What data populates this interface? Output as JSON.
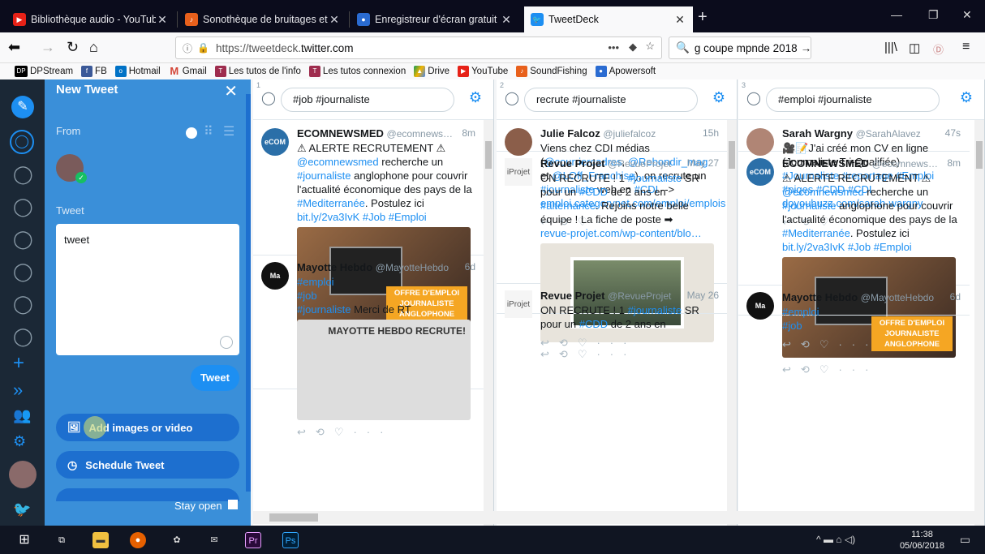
{
  "tabs": [
    {
      "title": "Bibliothèque audio - YouTube",
      "active": false
    },
    {
      "title": "Sonothèque de bruitages et mu",
      "active": false
    },
    {
      "title": "Enregistreur d'écran gratuit - e",
      "active": false
    },
    {
      "title": "TweetDeck",
      "active": true
    }
  ],
  "nav": {
    "url_prefix": "https://tweetdeck.",
    "url_domain": "twitter.com",
    "search": "ɡ coupe mpnde 2018"
  },
  "bookmarks": [
    "DPStream",
    "FB",
    "Hotmail",
    "Gmail",
    "Les tutos de l'info",
    "Les tutos connexion",
    "Drive",
    "YouTube",
    "SoundFishing",
    "Apowersoft"
  ],
  "compose": {
    "title": "New Tweet",
    "from_label": "From",
    "tweet_label": "Tweet",
    "tweet_text": "tweet",
    "tweet_button": "Tweet",
    "add_media": "Add images or video",
    "schedule": "Schedule Tweet",
    "stay_open": "Stay open"
  },
  "columns": [
    {
      "num": "1",
      "query": "#job #journaliste",
      "tweets": [
        {
          "name": "ECOMNEWSMED",
          "handle": "@ecomnews…",
          "time": "8m",
          "avatar": "ecom",
          "text_parts": [
            [
              "⚠ ALERTE RECRUTEMENT ⚠\n",
              ""
            ],
            [
              "@ecomnewsmed",
              "l"
            ],
            [
              " recherche un ",
              ""
            ],
            [
              "#journaliste",
              "l"
            ],
            [
              " anglophone pour couvrir l'actualité économique des pays de la ",
              ""
            ],
            [
              "#Mediterranée",
              "l"
            ],
            [
              ". Postulez ici ",
              ""
            ],
            [
              "bit.ly/2va3IvK #Job #Emploi",
              "l"
            ]
          ],
          "media": "OFFRE D'EMPLOI JOURNALISTE ANGLOPHONE"
        },
        {
          "name": "Mayotte Hebdo",
          "handle": "@MayotteHebdo",
          "time": "6d",
          "avatar": "Ma",
          "text_parts": [
            [
              "#emploi\n#job\n#journaliste",
              "l"
            ],
            [
              " Merci de RT",
              ""
            ]
          ],
          "media": "MAYOTTE HEBDO RECRUTE!"
        }
      ]
    },
    {
      "num": "2",
      "query": "recrute #journaliste",
      "tweets": [
        {
          "name": "Julie Falcoz",
          "handle": "@juliefalcoz",
          "time": "15h",
          "avatar": "jf",
          "text_parts": [
            [
              "Viens chez CDI médias (",
              ""
            ],
            [
              "@courriercadres",
              "l"
            ],
            [
              ", ",
              ""
            ],
            [
              "@Rebondir_mag",
              "l"
            ],
            [
              " et ",
              ""
            ],
            [
              "@LOff_Franchise",
              "l"
            ],
            [
              "), on recrute un ",
              ""
            ],
            [
              "#journaliste",
              "l"
            ],
            [
              " web en ",
              ""
            ],
            [
              "#CDI",
              "l"
            ],
            [
              " -->\n",
              ""
            ],
            [
              "emploi.categorynet.com/emploi/emplois…",
              "l"
            ]
          ],
          "media": ""
        },
        {
          "name": "Revue Projet",
          "handle": "@RevueProjet",
          "time": "May 27",
          "avatar": "iProjet",
          "text_parts": [
            [
              "ON RECRUTE ! 1 ",
              ""
            ],
            [
              "#journaliste",
              "l"
            ],
            [
              " SR pour un ",
              ""
            ],
            [
              "#CDD",
              "l"
            ],
            [
              " de 2 ans en ",
              ""
            ],
            [
              "#alternance",
              "l"
            ],
            [
              ". Rejoins notre belle équipe ! La fiche de poste ➡\n",
              ""
            ],
            [
              "revue-projet.com/wp-content/blo…",
              "l"
            ]
          ],
          "media": "photo"
        },
        {
          "name": "Revue Projet",
          "handle": "@RevueProjet",
          "time": "May 26",
          "avatar": "iProjet",
          "text_parts": [
            [
              "ON RECRUTE ! 1 ",
              ""
            ],
            [
              "#journaliste",
              "l"
            ],
            [
              " SR pour un ",
              ""
            ],
            [
              "#CDD",
              "l"
            ],
            [
              " de 2 ans en",
              ""
            ]
          ],
          "media": ""
        }
      ]
    },
    {
      "num": "3",
      "query": "#emploi #journaliste",
      "tweets": [
        {
          "name": "Sarah Wargny",
          "handle": "@SarahAlavez",
          "time": "47s",
          "avatar": "sw",
          "text_parts": [
            [
              "🎥📝J'ai créé mon CV en ligne (Journaliste Tri-Qualifiée)\n",
              ""
            ],
            [
              "#Journaliste #reportage #Emploi #piges #CDD #CDI\ndoyoubuzz.com/sarah-wargny",
              "l"
            ]
          ],
          "media": ""
        },
        {
          "name": "ECOMNEWSMED",
          "handle": "@ecomnews…",
          "time": "8m",
          "avatar": "ecom",
          "text_parts": [
            [
              "⚠ ALERTE RECRUTEMENT ⚠\n",
              ""
            ],
            [
              "@ecomnewsmed",
              "l"
            ],
            [
              " recherche un ",
              ""
            ],
            [
              "#journaliste",
              "l"
            ],
            [
              " anglophone pour couvrir l'actualité économique des pays de la ",
              ""
            ],
            [
              "#Mediterranée",
              "l"
            ],
            [
              ". Postulez ici ",
              ""
            ],
            [
              "bit.ly/2va3IvK #Job #Emploi",
              "l"
            ]
          ],
          "media": "OFFRE D'EMPLOI JOURNALISTE ANGLOPHONE"
        },
        {
          "name": "Mayotte Hebdo",
          "handle": "@MayotteHebdo",
          "time": "6d",
          "avatar": "Ma",
          "text_parts": [
            [
              "#emploi\n#job",
              "l"
            ]
          ],
          "media": ""
        }
      ]
    }
  ],
  "taskbar": {
    "time": "11:38",
    "date": "05/06/2018",
    "apps": [
      "Pr",
      "Ps"
    ]
  }
}
